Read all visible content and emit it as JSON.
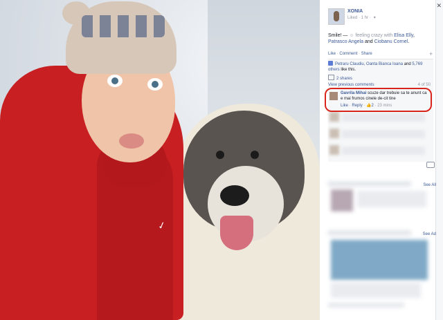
{
  "photo": {
    "alt": "Selfie with dog"
  },
  "post": {
    "author": "XONIA",
    "meta": "Liked · 1 hr ·",
    "status_prefix": "Smile! — ",
    "feeling": "feeling crazy with",
    "tagged1": "Elisa Elly",
    "sep1": ",",
    "tagged2": "Patrasco Angela",
    "sep2": "and",
    "tagged3": "Ciobanu Cornel",
    "end": "."
  },
  "actions": {
    "like": "Like",
    "comment": "Comment",
    "share": "Share",
    "sep": " · "
  },
  "likes": {
    "names": "Petraru Claudiu, Oanta Bianca Ioana",
    "and": "and",
    "others": "5,769 others",
    "suffix": "like this."
  },
  "shares": {
    "label": "2 shares"
  },
  "comments": {
    "view_previous": "View previous comments",
    "count": "4 of 50"
  },
  "highlighted_comment": {
    "name": "Gavrila Mihai",
    "text": "scuze dar trebuie sa te anunt ca e mai frumos cinele de-cit tine",
    "like": "Like",
    "reply": "Reply",
    "like_count": "2",
    "time": "23 mins"
  },
  "sidebar": {
    "see_all": "See All",
    "see_ad": "See Ad"
  },
  "colors": {
    "link": "#3b5998",
    "highlight": "#d9241b",
    "jacket": "#c81f22"
  },
  "icons": [
    "close-icon",
    "plus-icon",
    "thumbs-up-icon",
    "share-icon",
    "camera-icon",
    "chevron-down-icon"
  ]
}
